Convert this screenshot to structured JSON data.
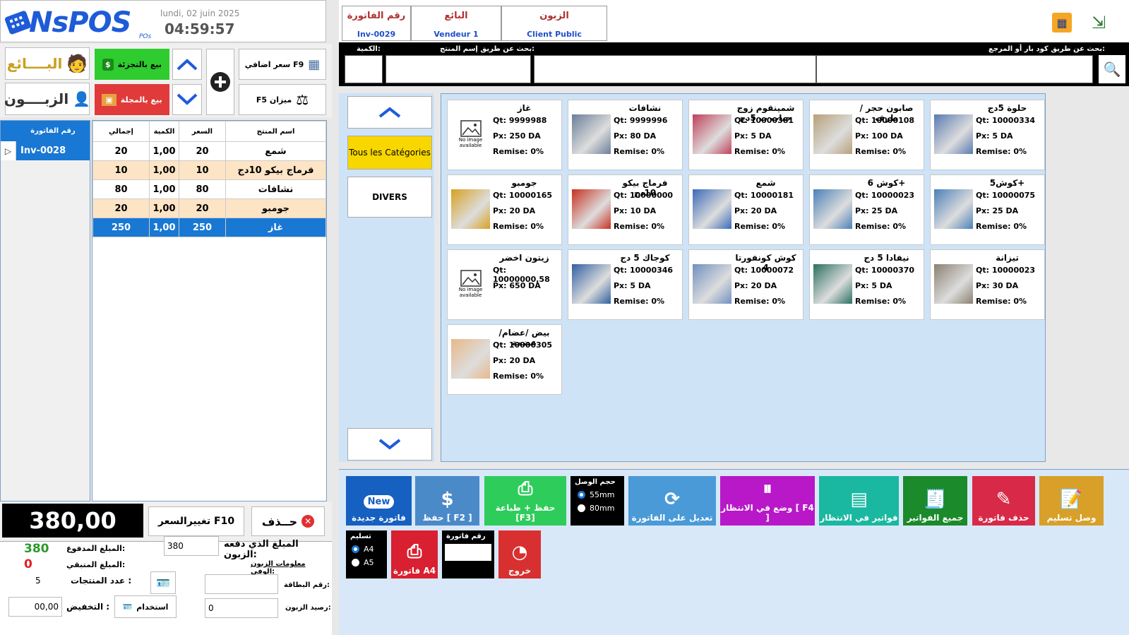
{
  "header": {
    "logo": "NsPOS",
    "logo_sub": "POs",
    "date": "lundi, 02 juin 2025",
    "time": "04:59:57"
  },
  "left_tiles": {
    "seller": "البــــائع",
    "customer": "الزبــــون",
    "retail": "بيع بالتجزئة",
    "wholesale": "بيع بالمجلة",
    "extra_price": "سعر اضافي F9",
    "scale": "F5 ميزان"
  },
  "invoice_list": {
    "header": "رقم الفاتورة",
    "items": [
      "Inv-0028"
    ]
  },
  "cart": {
    "headers": {
      "total": "إجمالي",
      "qty": "الكمية",
      "price": "السعر",
      "name": "اسم المنتج"
    },
    "rows": [
      {
        "total": "20",
        "qty": "1,00",
        "price": "20",
        "name": "شمع"
      },
      {
        "total": "10",
        "qty": "1,00",
        "price": "10",
        "name": "فرماج بيكو 10دج"
      },
      {
        "total": "80",
        "qty": "1,00",
        "price": "80",
        "name": "نشافات"
      },
      {
        "total": "20",
        "qty": "1,00",
        "price": "20",
        "name": "جومبو"
      },
      {
        "total": "250",
        "qty": "1,00",
        "price": "250",
        "name": "غاز"
      }
    ]
  },
  "totals": {
    "total": "380,00",
    "change_price": "تغييرالسعر F10",
    "delete": "حــذف"
  },
  "payment": {
    "paid_label": "المبلغ المدفوع:",
    "paid_value": "380",
    "remaining_label": "المبلغ المتبقي:",
    "remaining_value": "0",
    "count_label": "عدد المنتجات :",
    "count_value": "5",
    "discount_label": "التخفيض :",
    "discount_value": "00,00",
    "use_btn": "استخدام",
    "customer_paid_label": "المبلغ الذي دفعه الزبون:",
    "customer_paid_value": "380",
    "loyal_label": "معلومات الزبون الوفي:",
    "card_label": "رقم البطاقة:",
    "card_value": "",
    "balance_label": "رصيد الزبون:",
    "balance_value": "0"
  },
  "info": {
    "invoice_label": "رقم الفاتورة",
    "invoice_value": "Inv-0029",
    "seller_label": "البائع",
    "seller_value": "Vendeur 1",
    "customer_label": "الزبون",
    "customer_value": "Client Public"
  },
  "search": {
    "qty_label": "الكمية:",
    "name_label": "بحث عن طريق إسم المنتج:",
    "barcode_label": "بحث عن طريق كود بار أو المرجع:"
  },
  "categories": {
    "all": "Tous les Catégories",
    "divers": "DIVERS"
  },
  "products": [
    {
      "name": "غاز",
      "qt": "Qt: 9999988",
      "px": "Px: 250 DA",
      "remise": "Remise: 0%",
      "img": "none",
      "color": ""
    },
    {
      "name": "نشافات",
      "qt": "Qt: 9999996",
      "px": "Px: 80 DA",
      "remise": "Remise: 0%",
      "img": "photo",
      "color": "#6a7f99"
    },
    {
      "name": "شمينقوم زوج حبات ب 5دج",
      "qt": "Qt: 10000381",
      "px": "Px: 5 DA",
      "remise": "Remise: 0%",
      "img": "photo",
      "color": "#c0405a"
    },
    {
      "name": "صابون حجر /طرف",
      "qt": "Qt: 10000108",
      "px": "Px: 100 DA",
      "remise": "Remise: 0%",
      "img": "photo",
      "color": "#b8a07a"
    },
    {
      "name": "حلوة 5دج",
      "qt": "Qt: 10000334",
      "px": "Px: 5 DA",
      "remise": "Remise: 0%",
      "img": "photo",
      "color": "#5a7ab0"
    },
    {
      "name": "جومبو",
      "qt": "Qt: 10000165",
      "px": "Px: 20 DA",
      "remise": "Remise: 0%",
      "img": "photo",
      "color": "#d8a020"
    },
    {
      "name": "فرماج بيكو 10دج",
      "qt": "Qt: 10000000",
      "px": "Px: 10 DA",
      "remise": "Remise: 0%",
      "img": "photo",
      "color": "#c83020"
    },
    {
      "name": "شمع",
      "qt": "Qt: 10000181",
      "px": "Px: 20 DA",
      "remise": "Remise: 0%",
      "img": "photo",
      "color": "#3a6ab8"
    },
    {
      "name": "كوش 6+",
      "qt": "Qt: 10000023",
      "px": "Px: 25 DA",
      "remise": "Remise: 0%",
      "img": "photo",
      "color": "#4a80b8"
    },
    {
      "name": "كوش5+",
      "qt": "Qt: 10000075",
      "px": "Px: 25 DA",
      "remise": "Remise: 0%",
      "img": "photo",
      "color": "#4a80b8"
    },
    {
      "name": "زيتون اخضر",
      "qt": "Qt: 10000000,58",
      "px": "Px: 650 DA",
      "remise": "",
      "img": "none",
      "color": ""
    },
    {
      "name": "كوجاك 5 دج",
      "qt": "Qt: 10000346",
      "px": "Px: 5 DA",
      "remise": "Remise: 0%",
      "img": "photo",
      "color": "#3060a0"
    },
    {
      "name": "كوش كونفورتا 4",
      "qt": "Qt: 10000072",
      "px": "Px: 20 DA",
      "remise": "Remise: 0%",
      "img": "photo",
      "color": "#7090c0"
    },
    {
      "name": "نيفادا 5 دج",
      "qt": "Qt: 10000370",
      "px": "Px: 5 DA",
      "remise": "Remise: 0%",
      "img": "photo",
      "color": "#2a7060"
    },
    {
      "name": "تيزانة",
      "qt": "Qt: 10000023",
      "px": "Px: 30 DA",
      "remise": "Remise: 0%",
      "img": "photo",
      "color": "#8a8070"
    },
    {
      "name": "بيض /عضام/عضمة",
      "qt": "Qt: 10000305",
      "px": "Px: 20 DA",
      "remise": "Remise: 0%",
      "img": "photo",
      "color": "#e8b888"
    }
  ],
  "no_image": "No image available",
  "actions": {
    "new_badge": "New",
    "new": "فاتورة جديدة",
    "save": "حفظ [ F2 ]",
    "save_print": "حفظ + طباعة [F3]",
    "receipt_size": "حجم الوصل",
    "size55": "55mm",
    "size80": "80mm",
    "edit": "تعديل على الفاتورة",
    "hold": "وضع في الانتظار [ F4 ]",
    "pending": "فواتير في الانتظار",
    "all": "جميع الفواتير",
    "delete": "حذف فاتورة",
    "delivery": "وصل تسليم",
    "delivery_label": "تسليم",
    "a4": "A4",
    "a5": "A5",
    "a4_invoice": "فاتورة A4",
    "invoice_no": "رقم فاتورة",
    "exit": "خروج"
  },
  "colors": {
    "accent": "#1878d4",
    "retail": "#2fcc2f",
    "wholesale": "#e03a3a",
    "highlight": "#fde4c5",
    "total_bg": "#000000"
  }
}
